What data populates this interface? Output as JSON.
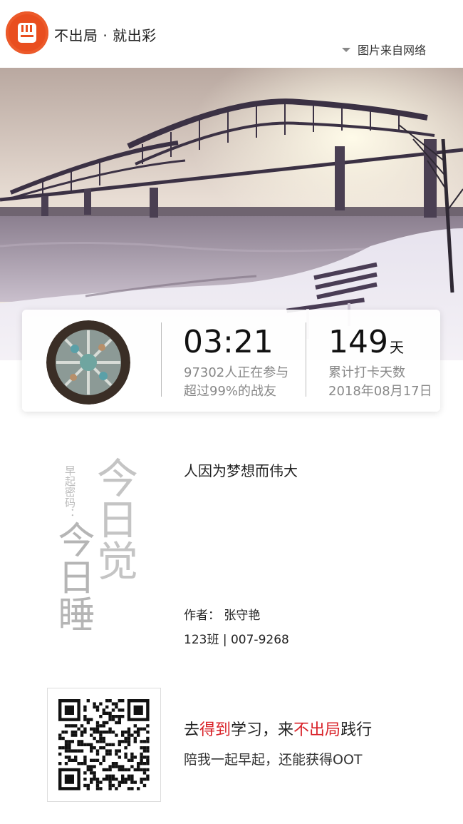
{
  "header": {
    "logo_icon": "fist-icon",
    "brand_text": "不出局 · 就出彩",
    "image_source": "图片来自网络",
    "accent_color": "#ec5a2a"
  },
  "stats": {
    "time": "03:21",
    "participants": "97302人正在参与",
    "rank": "超过99%的战友",
    "days_value": "149",
    "days_unit": "天",
    "days_label": "累计打卡天数",
    "date": "2018年08月17日"
  },
  "calligraphy": {
    "small_caption": "早起密码：",
    "big_text_1": "今日觉",
    "big_text_2": "今日睡"
  },
  "content": {
    "quote": "人因为梦想而伟大",
    "author": "作者：  张守艳",
    "class_info": "123班 | 007-9268"
  },
  "footer": {
    "line1_part1": "去",
    "line1_part2": "得到",
    "line1_part3": "学习，来",
    "line1_part4": "不出局",
    "line1_part5": "践行",
    "line2": "陪我一起早起，还能获得OOT",
    "highlight_color": "#d9232a"
  }
}
